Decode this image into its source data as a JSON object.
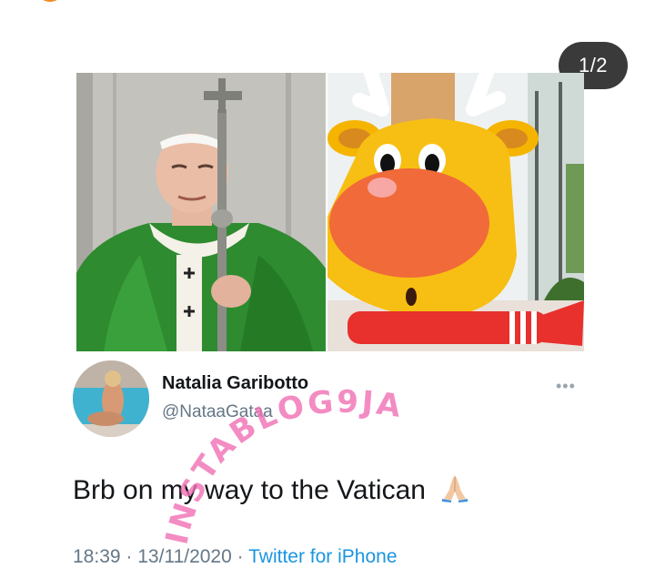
{
  "carousel": {
    "counter": "1/2"
  },
  "tweet": {
    "display_name": "Natalia Garibotto",
    "handle": "@NataaGataa",
    "text": "Brb on my way to the Vatican",
    "emoji_icon": "folded-hands-icon",
    "time": "18:39",
    "separator": "·",
    "date": "13/11/2020",
    "source": "Twitter for iPhone",
    "more_icon": "ellipsis-icon"
  },
  "watermark": {
    "text": "INSTABLOG9JA",
    "color": "#f06fb4"
  },
  "colors": {
    "counter_bg": "#3a3a3a",
    "link": "#1b95e0",
    "muted": "#657786",
    "accent_orange": "#f08a24"
  }
}
